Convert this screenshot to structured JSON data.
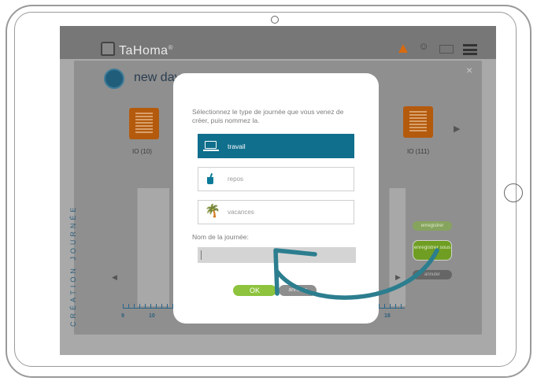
{
  "app": {
    "logo": "TaHoma",
    "logo_reg": "®",
    "icons": [
      "alert-icon",
      "user-icon",
      "mail-icon",
      "menu-icon"
    ]
  },
  "panel": {
    "title": "new day",
    "close": "×",
    "tiles": [
      {
        "label": "IO (10)"
      },
      {
        "label": "IO (111)"
      }
    ],
    "vertical_label": "CRÉATION JOURNÉE",
    "axis": {
      "left_ticks": [
        "9",
        "10"
      ],
      "right_ticks": [
        "18"
      ]
    },
    "buttons": {
      "save": "enregistrer",
      "save_as": "enregistrer sous",
      "cancel": "annuler"
    }
  },
  "modal": {
    "instruction": "Sélectionnez le type de journée que vous venez de créer, puis nommez la.",
    "options": [
      {
        "label": "travail",
        "icon": "laptop-icon",
        "selected": true
      },
      {
        "label": "repos",
        "icon": "drink-icon",
        "selected": false
      },
      {
        "label": "vacances",
        "icon": "palm-tree-icon",
        "selected": false
      }
    ],
    "name_label": "Nom de la journée:",
    "name_value": "",
    "ok": "OK",
    "cancel": "annuler"
  },
  "colors": {
    "accent_teal": "#0f6f8c",
    "ok_green": "#8dc33d",
    "orange": "#d66a13"
  }
}
